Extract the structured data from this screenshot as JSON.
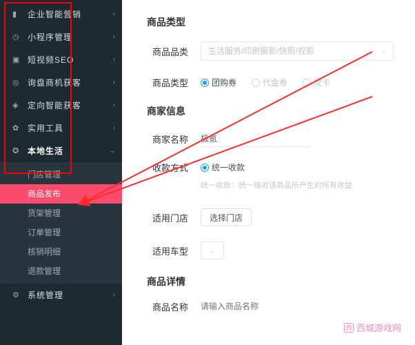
{
  "sidebar": {
    "items": [
      {
        "icon": "chart-icon",
        "label": "企业智能营销",
        "has_children": true
      },
      {
        "icon": "gear-icon",
        "label": "小程序管理",
        "has_children": true
      },
      {
        "icon": "video-icon",
        "label": "短视频SEO",
        "has_children": true
      },
      {
        "icon": "inquiry-icon",
        "label": "询盘商机获客",
        "has_children": true
      },
      {
        "icon": "target-icon",
        "label": "定向智能获客",
        "has_children": true
      },
      {
        "icon": "tool-icon",
        "label": "实用工具",
        "has_children": true
      },
      {
        "icon": "location-icon",
        "label": "本地生活",
        "has_children": true,
        "expanded": true
      },
      {
        "icon": "system-icon",
        "label": "系统管理",
        "has_children": true
      }
    ],
    "local_life_children": [
      {
        "label": "门店管理",
        "active": false
      },
      {
        "label": "商品发布",
        "active": true
      },
      {
        "label": "货架管理",
        "active": false
      },
      {
        "label": "订单管理",
        "active": false
      },
      {
        "label": "核销明细",
        "active": false
      },
      {
        "label": "退款管理",
        "active": false
      }
    ]
  },
  "form": {
    "section_type_title": "商品类型",
    "product_category_label": "商品品类",
    "product_category_placeholder": "生活服务/印刷摄影/快照/视影",
    "product_type_label": "商品类型",
    "product_type_options": [
      "团购券",
      "代金券",
      "次卡"
    ],
    "section_merchant_title": "商家信息",
    "merchant_name_label": "商家名称",
    "merchant_name_value": "极氪",
    "collection_label": "收款方式",
    "collection_options": [
      "统一收款"
    ],
    "collection_helper": "统一收款：统一接收该商品所产生的所有收益",
    "store_label": "适用门店",
    "store_button": "选择门店",
    "car_label": "适用车型",
    "section_detail_title": "商品详情",
    "product_name_label": "商品名称",
    "product_name_placeholder": "请输入商品名称"
  },
  "watermark": {
    "text": "西城游戏网"
  }
}
